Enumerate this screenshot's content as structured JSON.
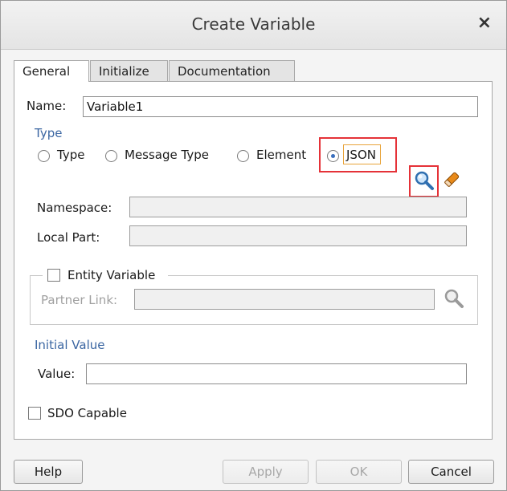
{
  "dialog": {
    "title": "Create Variable",
    "close_glyph": "×"
  },
  "tabs": [
    {
      "label": "General",
      "active": true
    },
    {
      "label": "Initialize",
      "active": false
    },
    {
      "label": "Documentation",
      "active": false
    }
  ],
  "general": {
    "name_label": "Name:",
    "name_value": "Variable1",
    "type_section": "Type",
    "type_options": [
      {
        "label": "Type",
        "selected": false
      },
      {
        "label": "Message Type",
        "selected": false
      },
      {
        "label": "Element",
        "selected": false
      },
      {
        "label": "JSON",
        "selected": true
      }
    ],
    "browse_icon": "magnifier-icon",
    "clear_icon": "eraser-icon",
    "namespace_label": "Namespace:",
    "namespace_value": "",
    "local_part_label": "Local Part:",
    "local_part_value": "",
    "entity_variable_label": "Entity Variable",
    "partner_link_label": "Partner Link:",
    "partner_link_value": "",
    "initial_value_section": "Initial Value",
    "value_label": "Value:",
    "value_value": "",
    "sdo_capable_label": "SDO Capable"
  },
  "footer": {
    "help": "Help",
    "apply": "Apply",
    "ok": "OK",
    "cancel": "Cancel"
  },
  "colors": {
    "section_text": "#3b66a2",
    "highlight": "#e53238",
    "focus": "#e8a33a"
  }
}
